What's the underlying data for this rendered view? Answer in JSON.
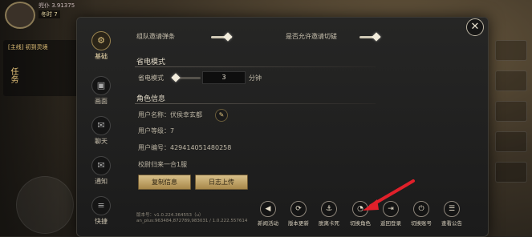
{
  "hud": {
    "player_name": "兜仆 3.91375",
    "player_level": "冬时 7",
    "task_title": "[主线] 初到灵境",
    "task_tab": "任务"
  },
  "sidebar": {
    "items": [
      {
        "label": "基础",
        "icon": "gear-icon",
        "glyph": "⚙",
        "active": true
      },
      {
        "label": "画面",
        "icon": "display-icon",
        "glyph": "▣",
        "active": false
      },
      {
        "label": "聊天",
        "icon": "chat-icon",
        "glyph": "✉",
        "active": false
      },
      {
        "label": "通知",
        "icon": "mail-icon",
        "glyph": "✉",
        "active": false
      },
      {
        "label": "快捷",
        "icon": "shortcut-icon",
        "glyph": "≡",
        "active": false
      }
    ]
  },
  "settings": {
    "team_invite_label": "组队邀请弹条",
    "team_invite_on": true,
    "allow_switch_label": "是否允许邀请切磋",
    "allow_switch_on": true,
    "power_section_title": "省电模式",
    "power_mode_label": "省电模式",
    "power_minutes_value": "3",
    "power_unit": "分钟",
    "role_section_title": "角色信息",
    "user_name_label": "用户名称：伏侯幸玄都",
    "user_level_label": "用户等级：7",
    "user_id_label": "用户编号：429414051480258",
    "server_label": "校尉归来一合1服",
    "copy_info_button": "复制信息",
    "log_upload_button": "日志上传"
  },
  "actions": [
    {
      "label": "新闻活动",
      "icon": "megaphone-icon",
      "glyph": "◀"
    },
    {
      "label": "版本更新",
      "icon": "refresh-icon",
      "glyph": "⟳"
    },
    {
      "label": "脱离卡死",
      "icon": "anchor-icon",
      "glyph": "⚓"
    },
    {
      "label": "切换角色",
      "icon": "switch-role-icon",
      "glyph": "◔"
    },
    {
      "label": "返回登录",
      "icon": "logout-icon",
      "glyph": "⇥"
    },
    {
      "label": "切换账号",
      "icon": "power-icon",
      "glyph": "⏻"
    },
    {
      "label": "查看公告",
      "icon": "notice-icon",
      "glyph": "☰"
    }
  ],
  "version": {
    "line1": "版本号：v1.0.224.364553（u）",
    "line2": "an_plus:963484,872789,983031 / 1.0.222.557614"
  },
  "close_label": "✕",
  "colors": {
    "accent_gold": "#d8c08a",
    "arrow_red": "#e0202a",
    "dialog_bg": "#1f1f20"
  }
}
